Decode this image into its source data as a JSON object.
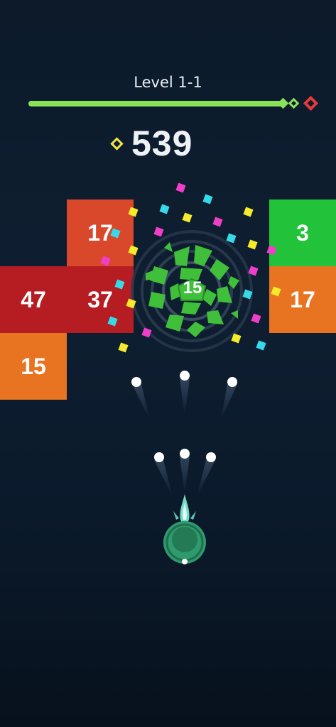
{
  "header": {
    "level_title": "Level 1-1",
    "progress": 0.85
  },
  "score": {
    "value": "539",
    "icon": "diamond-icon"
  },
  "blocks": [
    {
      "value": "17",
      "color": "#d9482b"
    },
    {
      "value": "3",
      "color": "#22c23b"
    },
    {
      "value": "47",
      "color": "#b51d23"
    },
    {
      "value": "37",
      "color": "#b51d23"
    },
    {
      "value": "17",
      "color": "#e87422"
    },
    {
      "value": "15",
      "color": "#e87422"
    }
  ],
  "target": {
    "value": "15",
    "color": "#3fbf3a"
  },
  "colors": {
    "progress_fill": "#8be25a",
    "milestone_green": "#8be25a",
    "milestone_red": "#e33a3a",
    "score_icon": "#f2e34a",
    "cannon": "#2f9a6d",
    "flame": "#7ff2d6"
  }
}
